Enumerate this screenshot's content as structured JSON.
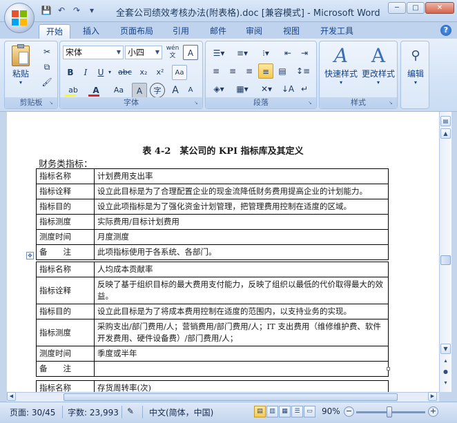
{
  "window": {
    "title": "全套公司绩效考核办法(附表格).doc [兼容模式] - Microsoft Word",
    "minimize": "─",
    "maximize": "□",
    "close": "✕"
  },
  "quick_access": {
    "save": "💾",
    "undo": "↶",
    "redo": "↷",
    "customize": "▾"
  },
  "tabs": [
    {
      "label": "开始",
      "active": true
    },
    {
      "label": "插入"
    },
    {
      "label": "页面布局"
    },
    {
      "label": "引用"
    },
    {
      "label": "邮件"
    },
    {
      "label": "审阅"
    },
    {
      "label": "视图"
    },
    {
      "label": "开发工具"
    }
  ],
  "help": "?",
  "ribbon": {
    "clipboard": {
      "label": "剪贴板",
      "paste": "粘贴"
    },
    "font": {
      "label": "字体",
      "font_name": "宋体",
      "font_size": "小四",
      "bold": "B",
      "italic": "I",
      "underline": "U",
      "strike": "abc",
      "subscript": "x₂",
      "superscript": "x²",
      "font_color": "A",
      "change_case": "Aa",
      "char_shading": "A",
      "enclose": "字",
      "grow": "A",
      "shrink": "A",
      "phonetic": "wén",
      "border_char": "A"
    },
    "paragraph": {
      "label": "段落"
    },
    "styles": {
      "label": "样式",
      "quick": "快速样式",
      "change": "更改样式"
    },
    "editing": {
      "label": "编辑"
    }
  },
  "document": {
    "caption": "表 4-2　某公司的 KPI 指标库及其定义",
    "subheading": "财务类指标：",
    "tables": [
      {
        "rows": [
          {
            "k": "指标名称",
            "v": "计划费用支出率"
          },
          {
            "k": "指标诠释",
            "v": "设立此目标是为了合理配置企业的现金流降低财务费用提高企业的计划能力。"
          },
          {
            "k": "指标目的",
            "v": "设立此项指标是为了强化资金计划管理，把管理费用控制在适度的区域。"
          },
          {
            "k": "指标测度",
            "v": "实际费用/目标计划费用"
          },
          {
            "k": "测度时间",
            "v": "月度测度"
          },
          {
            "k": "备　　注",
            "v": "此项指标使用于各系统、各部门。"
          }
        ]
      },
      {
        "rows": [
          {
            "k": "指标名称",
            "v": "人均成本贡献率"
          },
          {
            "k": "指标诠释",
            "v": "反映了基于组织目标的最大费用支付能力，反映了组织以最低的代价取得最大的效益。"
          },
          {
            "k": "指标目的",
            "v": "设立此目标是为了将成本费用控制在适度的范围内，以支持业务的实现。"
          },
          {
            "k": "指标测度",
            "v": "采购支出/部门费用/人；营销费用/部门费用/人；IT 支出费用（维修维护费、软件开发费用、硬件设备费）/部门费用/人；"
          },
          {
            "k": "测度时间",
            "v": "季度或半年"
          },
          {
            "k": "备　　注",
            "v": ""
          }
        ]
      },
      {
        "rows": [
          {
            "k": "指标名称",
            "v": "存货周转率(次)"
          }
        ]
      }
    ]
  },
  "status": {
    "page": "页面: 30/45",
    "words": "字数: 23,993",
    "language": "中文(简体，中国)",
    "zoom": "90%",
    "zoom_minus": "−",
    "zoom_plus": "+"
  }
}
